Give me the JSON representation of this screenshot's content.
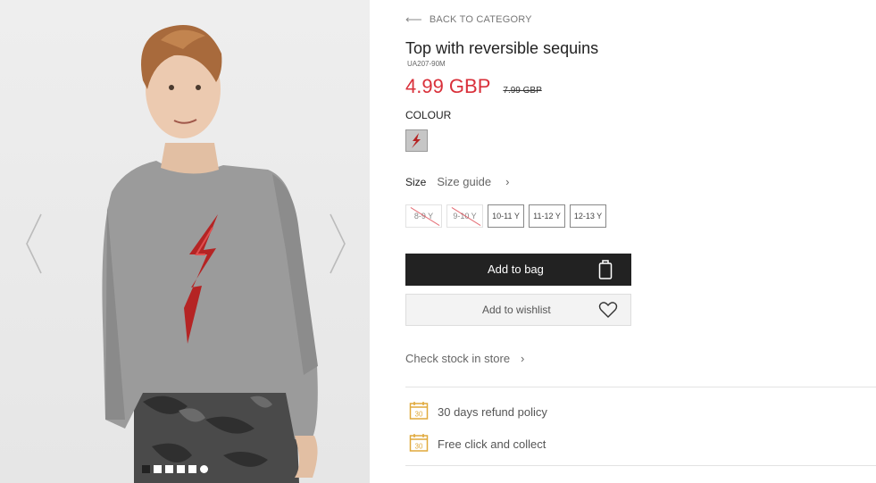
{
  "nav": {
    "back_label": "BACK TO CATEGORY"
  },
  "product": {
    "title": "Top with reversible sequins",
    "sku": "UA207-90M",
    "price": "4.99 GBP",
    "old_price": "7.99 GBP"
  },
  "colour": {
    "label": "COLOUR",
    "swatch_color": "#b52424"
  },
  "size": {
    "label": "Size",
    "guide_label": "Size guide",
    "options": [
      {
        "label": "8-9 Y",
        "available": false
      },
      {
        "label": "9-10 Y",
        "available": false
      },
      {
        "label": "10-11 Y",
        "available": true
      },
      {
        "label": "11-12 Y",
        "available": true
      },
      {
        "label": "12-13 Y",
        "available": true
      }
    ]
  },
  "actions": {
    "add_to_bag": "Add to bag",
    "add_to_wishlist": "Add to wishlist",
    "check_stock": "Check stock in store"
  },
  "perks": [
    {
      "icon": "calendar-icon",
      "icon_text": "30",
      "label": "30 days refund policy"
    },
    {
      "icon": "calendar-icon",
      "icon_text": "30",
      "label": "Free click and collect"
    }
  ],
  "gallery": {
    "image_count": 6,
    "active_index": 0
  },
  "colors": {
    "accent_red": "#d9303a",
    "button_dark": "#222222",
    "perk_icon": "#e0a93b"
  }
}
